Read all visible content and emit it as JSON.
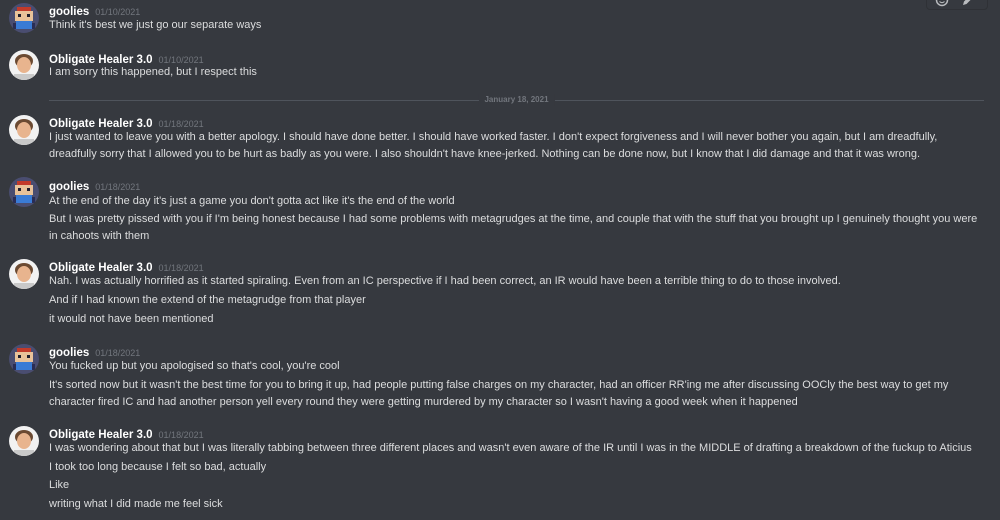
{
  "colors": {
    "background": "#36393f",
    "username": "#ffffff",
    "text": "#dcddde",
    "timestamp": "#72767d"
  },
  "toolbar": {
    "icons": [
      "add-reaction-icon",
      "edit-icon"
    ]
  },
  "divider": {
    "label": "January 18, 2021"
  },
  "groups": [
    {
      "author": "goolies",
      "avatar": "pixel-character-avatar",
      "timestamp": "01/10/2021",
      "lines": [
        "Think it's best we just go our separate ways"
      ]
    },
    {
      "author": "Obligate Healer 3.0",
      "avatar": "person-avatar",
      "timestamp": "01/10/2021",
      "lines": [
        "I am sorry this happened, but I respect this"
      ]
    },
    {
      "author": "Obligate Healer 3.0",
      "avatar": "person-avatar",
      "timestamp": "01/18/2021",
      "lines": [
        "I just wanted to leave you with a better apology. I should have done better. I should have worked faster. I don't expect forgiveness and I will never bother you again, but I am dreadfully, dreadfully sorry that I allowed you to be hurt as badly as you were. I also shouldn't have knee-jerked. Nothing can be done now, but I know that I did damage and that it was wrong."
      ]
    },
    {
      "author": "goolies",
      "avatar": "pixel-character-avatar",
      "timestamp": "01/18/2021",
      "lines": [
        "At the end of the day it's just a game you don't gotta act like it's the end of the world",
        "But I was pretty pissed with you if I'm being honest because I had some problems with metagrudges at the time, and couple that with the stuff that you brought up I genuinely thought you were in cahoots with them"
      ]
    },
    {
      "author": "Obligate Healer 3.0",
      "avatar": "person-avatar",
      "timestamp": "01/18/2021",
      "lines": [
        "Nah. I was actually horrified as it started spiraling. Even from an IC perspective if I had been correct, an IR would have been a terrible thing to do to those involved.",
        "And if I had known the extend of the metagrudge from that player",
        "it would not have been mentioned"
      ]
    },
    {
      "author": "goolies",
      "avatar": "pixel-character-avatar",
      "timestamp": "01/18/2021",
      "lines": [
        "You fucked up but you apologised so that's cool, you're cool",
        "It's sorted now but it wasn't the best time for you to bring it up, had people putting false charges on my character, had an officer RR'ing me after discussing OOCly the best way to get my character fired IC and had another person yell every round they were getting murdered by my character so I wasn't having a good week when it happened"
      ]
    },
    {
      "author": "Obligate Healer 3.0",
      "avatar": "person-avatar",
      "timestamp": "01/18/2021",
      "lines": [
        "I was wondering about that but I was literally tabbing between three different places and wasn't even aware of the IR until I was in the MIDDLE of drafting a breakdown of the fuckup to Aticius",
        "I took too long because I felt so bad, actually",
        "Like",
        "writing what I did made me feel sick"
      ]
    }
  ]
}
